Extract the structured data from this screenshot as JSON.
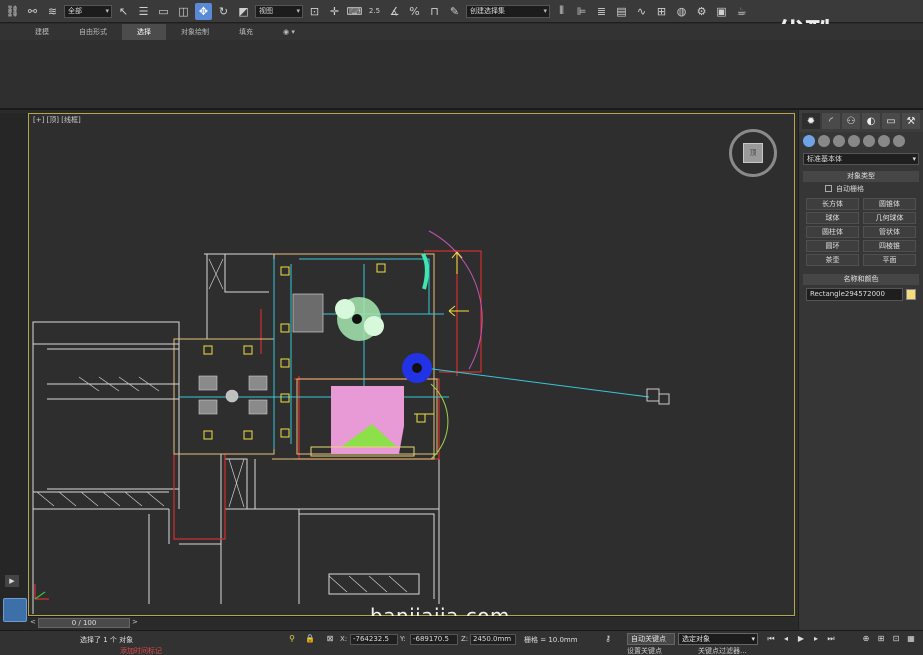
{
  "toolbar": {
    "selection_filter": "全部",
    "ref_coord": "视图",
    "snap_value": "2.5",
    "named_selection": "创建选择集",
    "icons": [
      "link-icon",
      "unlink-icon",
      "bind-space-warp-icon",
      "select-icon",
      "select-by-name-icon",
      "rect-region-icon",
      "window-crossing-icon",
      "move-icon",
      "rotate-icon",
      "scale-icon",
      "pivot-icon",
      "select-manipulate-icon",
      "keyboard-shortcut-icon",
      "snap-icon",
      "angle-snap-icon",
      "percent-snap-icon",
      "spinner-snap-icon",
      "edit-named-selection-icon",
      "mirror-icon",
      "align-icon",
      "layer-icon",
      "graphite-icon",
      "curve-editor-icon",
      "schematic-icon",
      "material-editor-icon",
      "render-setup-icon",
      "rendered-frame-icon",
      "render-icon"
    ]
  },
  "ribbon": {
    "tabs": [
      "建模",
      "自由形式",
      "选择",
      "对象绘制",
      "填充"
    ],
    "active": "选择"
  },
  "viewport": {
    "label": "[+] [顶] [线框]",
    "viewcube_face": "顶"
  },
  "watermarks": {
    "site": "banjiajia.com",
    "logo": "优酷"
  },
  "command_panel": {
    "dropdown": "标准基本体",
    "object_type_title": "对象类型",
    "auto_grid": "自动栅格",
    "object_buttons": [
      "长方体",
      "圆锥体",
      "球体",
      "几何球体",
      "圆柱体",
      "管状体",
      "圆环",
      "四棱锥",
      "茶壶",
      "平面"
    ],
    "name_color_title": "名称和颜色",
    "object_name": "Rectangle294572000",
    "object_color": "#f2dc7c"
  },
  "timeline": {
    "frame": "0 / 100"
  },
  "status": {
    "message": "选择了 1 个 对象",
    "x_label": "X:",
    "x_value": "-764232.5",
    "y_label": "Y:",
    "y_value": "-689170.5",
    "z_label": "Z:",
    "z_value": "2450.0mm",
    "grid": "栅格 = 10.0mm",
    "autokey": "自动关键点",
    "set_key": "设置关键点",
    "selection_mode": "选定对象",
    "key_filter": "关键点过滤器...",
    "add_time_tag": "添加时间标记"
  }
}
